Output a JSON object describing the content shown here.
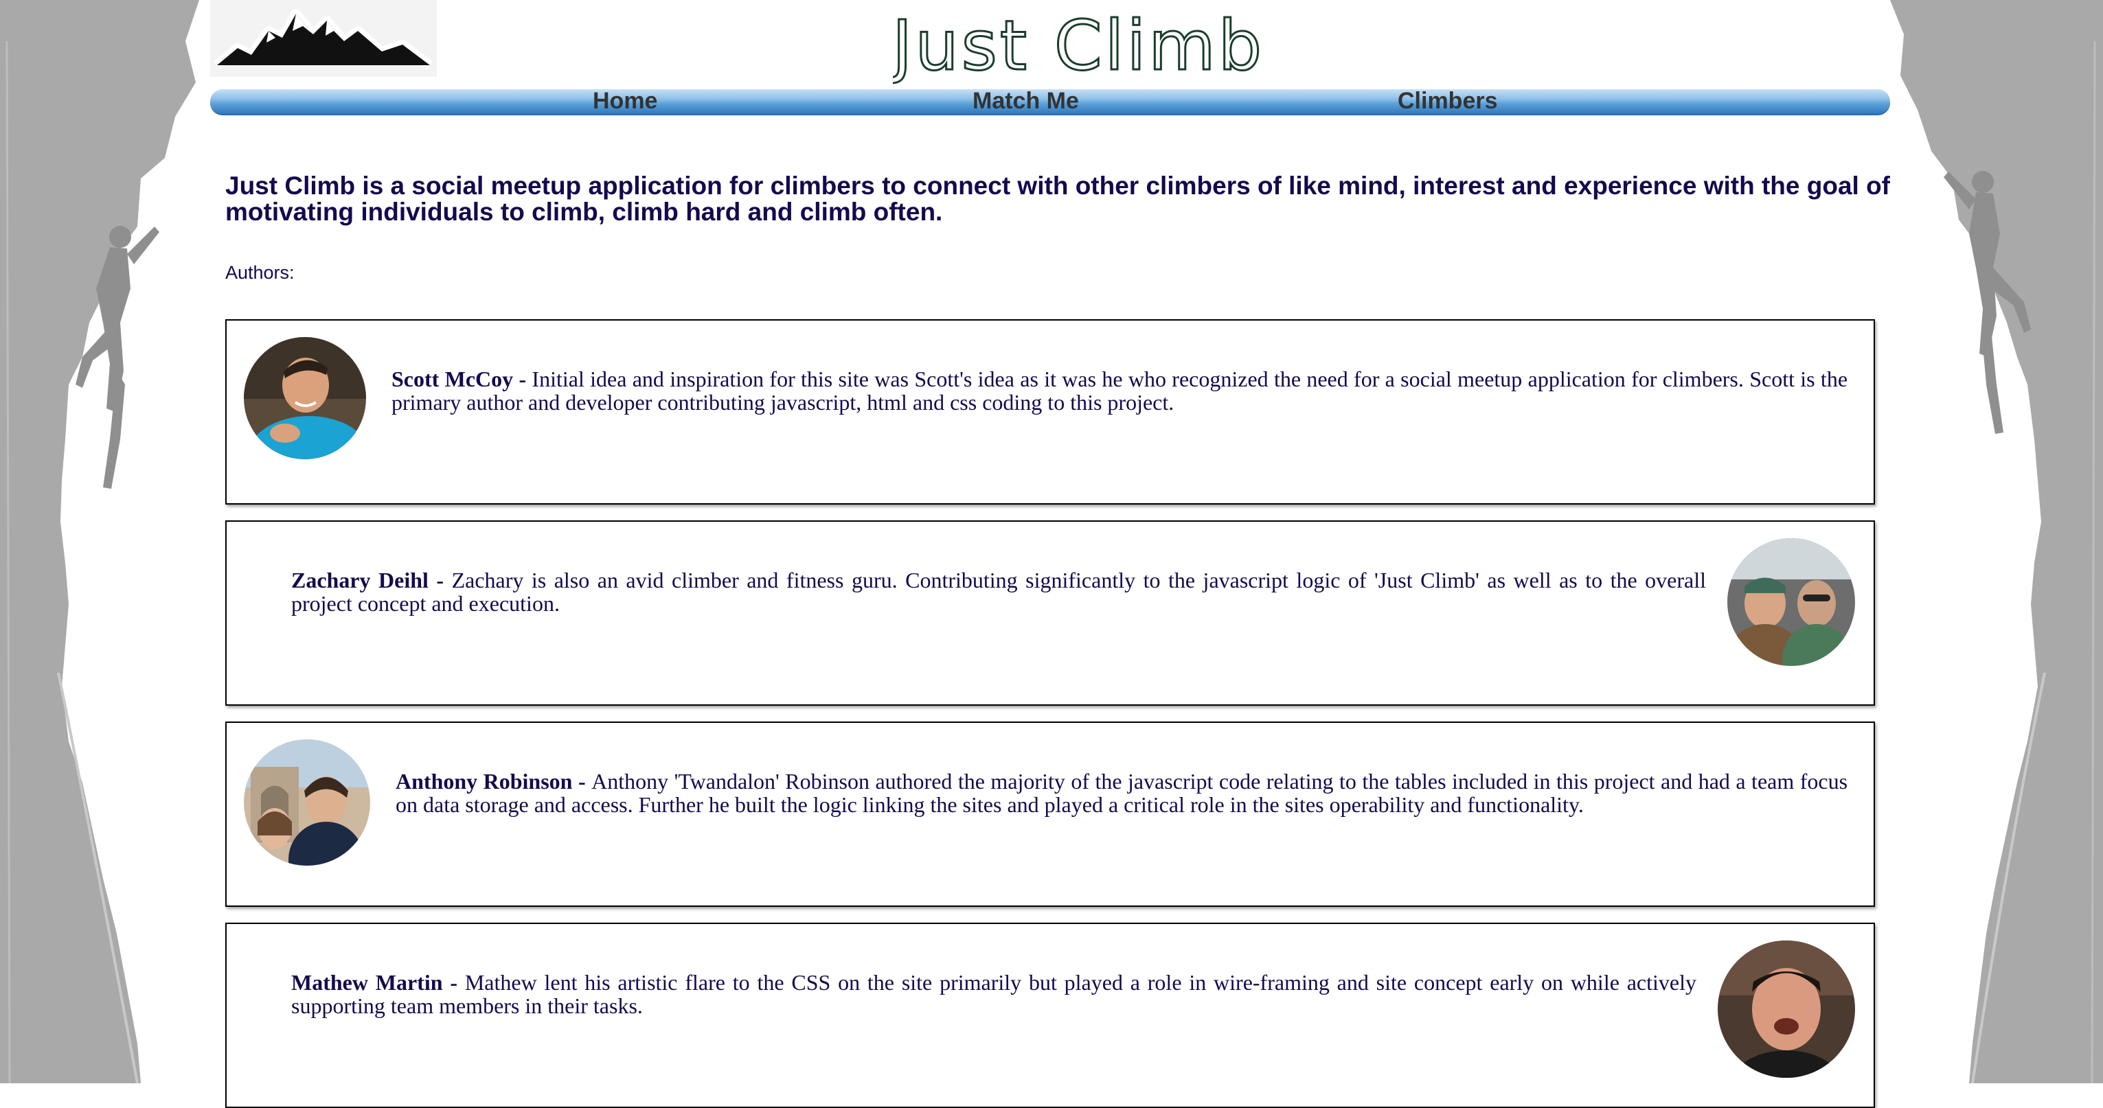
{
  "header": {
    "site_title": "Just Climb",
    "logo_icon": "mountain-logo"
  },
  "nav": {
    "items": [
      {
        "label": "Home"
      },
      {
        "label": "Match Me"
      },
      {
        "label": "Climbers"
      }
    ]
  },
  "intro": "Just Climb is a social meetup application for climbers to connect with other climbers of like mind, interest and experience with the goal of motivating individuals to climb, climb hard and climb often.",
  "authors_label": "Authors:",
  "authors": [
    {
      "name": "Scott McCoy",
      "separator": " - ",
      "bio": "Initial idea and inspiration for this site was Scott's idea as it was he who recognized the need for a social meetup application for climbers. Scott is the primary author and developer contributing javascript, html and css coding to this project."
    },
    {
      "name": "Zachary Deihl",
      "separator": " - ",
      "bio": "Zachary is also an avid climber and fitness guru. Contributing significantly to the javascript logic of 'Just Climb' as well as to the overall project concept and execution."
    },
    {
      "name": "Anthony Robinson",
      "separator": " - ",
      "bio": "Anthony 'Twandalon' Robinson authored the majority of the javascript code relating to the tables included in this project and had a team focus on data storage and access. Further he built the logic linking the sites and played a critical role in the sites operability and functionality."
    },
    {
      "name": "Mathew Martin",
      "separator": " - ",
      "bio": "Mathew lent his artistic flare to the CSS on the site primarily but played a role in wire-framing and site concept early on while actively supporting team members in their tasks."
    }
  ],
  "colors": {
    "text_navy": "#140a4e",
    "nav_blue": "#5a9fd8",
    "cliff_gray": "#a9a9a9"
  }
}
